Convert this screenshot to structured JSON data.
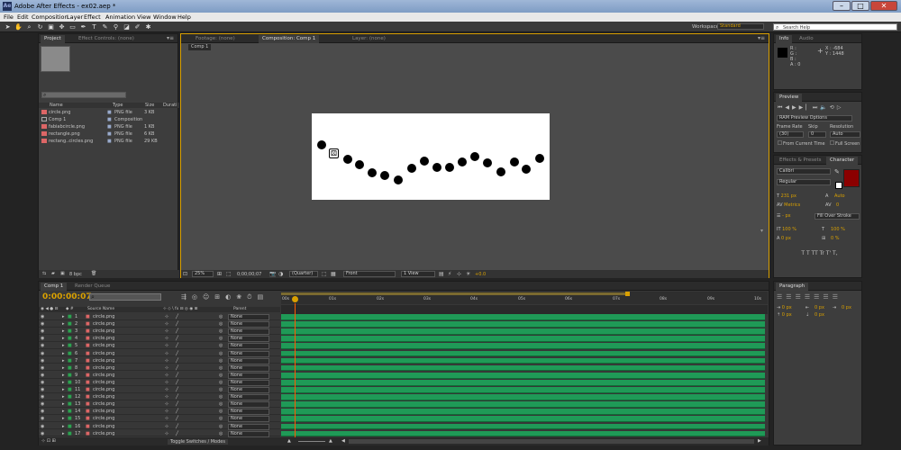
{
  "window": {
    "title": "Adobe After Effects - ex02.aep *",
    "min": "–",
    "max": "□",
    "close": "✕"
  },
  "menu": [
    "File",
    "Edit",
    "Composition",
    "Layer",
    "Effect",
    "Animation",
    "View",
    "Window",
    "Help"
  ],
  "workspace": {
    "label": "Workspace:",
    "value": "Standard"
  },
  "search_help": {
    "placeholder": "Search Help"
  },
  "project": {
    "tabs": [
      "Project",
      "Effect Controls: (none)"
    ],
    "columns": [
      "Name",
      "Type",
      "Size",
      "Durati"
    ],
    "items": [
      {
        "name": "circle.png",
        "type": "PNG file",
        "size": "3 KB"
      },
      {
        "name": "Comp 1",
        "type": "Composition",
        "size": ""
      },
      {
        "name": "fabiabcircle.png",
        "type": "PNG file",
        "size": "1 KB"
      },
      {
        "name": "rectangle.png",
        "type": "PNG file",
        "size": "6 KB"
      },
      {
        "name": "rectang..circles.png",
        "type": "PNG file",
        "size": "29 KB"
      }
    ],
    "bpc": "8 bpc"
  },
  "viewer": {
    "tabs": [
      "Footage: (none)",
      "Composition: Comp 1",
      "Layer: (none)"
    ],
    "comp_label": "Comp 1",
    "zoom": "25%",
    "time": "0;00;00;07",
    "resolution": "(Quarter)",
    "view": "Front",
    "views": "1 View",
    "offset": "+0.0"
  },
  "info": {
    "tabs": [
      "Info",
      "Audio"
    ],
    "r": "R :",
    "g": "G :",
    "b": "B :",
    "a": "A : 0",
    "x": "X : -684",
    "y": "Y : 1448"
  },
  "preview": {
    "tab": "Preview",
    "ram": "RAM Preview Options",
    "frame_rate": "Frame Rate",
    "skip": "Skip",
    "resolution": "Resolution",
    "fr_val": "(30)",
    "skip_val": "0",
    "res_val": "Auto",
    "from_current": "From Current Time",
    "full_screen": "Full Screen"
  },
  "character": {
    "tabs": [
      "Effects & Presets",
      "Character"
    ],
    "font": "Calibri",
    "style": "Regular",
    "size": "231 px",
    "leading": "Auto",
    "kerning": "Metrics",
    "tracking": "0",
    "stroke": "- px",
    "stroke_mode": "Fill Over Stroke",
    "vscale": "100 %",
    "hscale": "100 %",
    "baseline": "0 px",
    "tsume": "0 %",
    "styles": "T  T  TT  Tr  T'  T,",
    "color": "#8b0000"
  },
  "paragraph": {
    "tab": "Paragraph",
    "v1": "0 px",
    "v2": "0 px",
    "v3": "0 px",
    "v4": "0 px",
    "v5": "0 px"
  },
  "timeline": {
    "tabs": [
      "Comp 1",
      "Render Queue"
    ],
    "timecode": "0:00:00:07",
    "col_source": "Source Name",
    "col_parent": "Parent",
    "ruler": [
      "00s",
      "01s",
      "02s",
      "03s",
      "04s",
      "05s",
      "06s",
      "07s",
      "08s",
      "09s",
      "10s"
    ],
    "toggle": "Toggle Switches / Modes",
    "layers": [
      {
        "num": "1",
        "name": "circle.png",
        "parent": "None"
      },
      {
        "num": "2",
        "name": "circle.png",
        "parent": "None"
      },
      {
        "num": "3",
        "name": "circle.png",
        "parent": "None"
      },
      {
        "num": "4",
        "name": "circle.png",
        "parent": "None"
      },
      {
        "num": "5",
        "name": "circle.png",
        "parent": "None"
      },
      {
        "num": "6",
        "name": "circle.png",
        "parent": "None"
      },
      {
        "num": "7",
        "name": "circle.png",
        "parent": "None"
      },
      {
        "num": "8",
        "name": "circle.png",
        "parent": "None"
      },
      {
        "num": "9",
        "name": "circle.png",
        "parent": "None"
      },
      {
        "num": "10",
        "name": "circle.png",
        "parent": "None"
      },
      {
        "num": "11",
        "name": "circle.png",
        "parent": "None"
      },
      {
        "num": "12",
        "name": "circle.png",
        "parent": "None"
      },
      {
        "num": "13",
        "name": "circle.png",
        "parent": "None"
      },
      {
        "num": "14",
        "name": "circle.png",
        "parent": "None"
      },
      {
        "num": "15",
        "name": "circle.png",
        "parent": "None"
      },
      {
        "num": "16",
        "name": "circle.png",
        "parent": "None"
      },
      {
        "num": "17",
        "name": "circle.png",
        "parent": "None"
      }
    ]
  },
  "colors": {
    "accent": "#d9a000",
    "track": "#1f9a57",
    "playhead": "#ff5a00"
  }
}
